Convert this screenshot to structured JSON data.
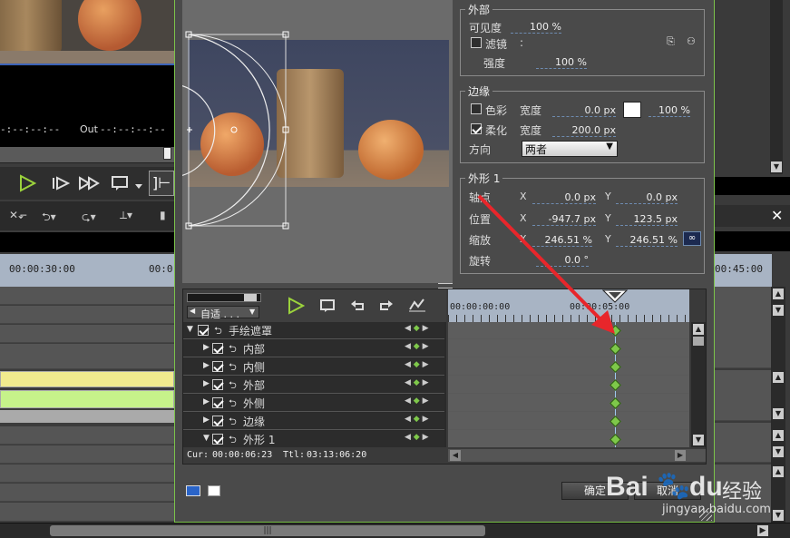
{
  "left": {
    "out_label": "Out",
    "in_tc": "-:--:--:--",
    "out_tc": "--:--:--:--",
    "ruler_tc": "00:00:30:00",
    "ruler_tc2": "00:0"
  },
  "right_ruler_tc": "00:45:00",
  "groups": {
    "inner": {
      "title": "外部",
      "visibility_label": "可见度",
      "visibility_value": "100 %",
      "filter_label": "滤镜",
      "filter_value": ":",
      "strength_label": "强度",
      "strength_value": "100 %"
    },
    "edge": {
      "title": "边缘",
      "color_label": "色彩",
      "width_label": "宽度",
      "color_width": "0.0 px",
      "color_opacity": "100 %",
      "soften_label": "柔化",
      "soften_width": "200.0 px",
      "direction_label": "方向",
      "direction_value": "两者"
    },
    "shape": {
      "title": "外形 1",
      "axis_label": "轴点",
      "axis_x": "0.0 px",
      "axis_y": "0.0 px",
      "pos_label": "位置",
      "pos_x": "-947.7 px",
      "pos_y": "123.5 px",
      "scale_label": "缩放",
      "scale_x": "246.51 %",
      "scale_y": "246.51 %",
      "rotate_label": "旋转",
      "rotate_value": "0.0 °",
      "x_label": "X",
      "y_label": "Y"
    }
  },
  "keyframe": {
    "preset_label": "自适 . . .",
    "ruler_start": "00:00:00:00",
    "ruler_mid": "00:00:05:00",
    "tracks": [
      {
        "label": "手绘遮罩",
        "level": 0,
        "expanded": true
      },
      {
        "label": "内部",
        "level": 1,
        "expanded": false
      },
      {
        "label": "内侧",
        "level": 1,
        "expanded": false
      },
      {
        "label": "外部",
        "level": 1,
        "expanded": false
      },
      {
        "label": "外侧",
        "level": 1,
        "expanded": false
      },
      {
        "label": "边缘",
        "level": 1,
        "expanded": false
      },
      {
        "label": "外形 1",
        "level": 1,
        "expanded": true
      }
    ],
    "cur_label": "Cur:",
    "cur_value": "00:00:06:23",
    "ttl_label": "Ttl:",
    "ttl_value": "03:13:06:20"
  },
  "buttons": {
    "ok": "确定",
    "cancel": "取消"
  },
  "watermark": {
    "brand": "Bai",
    "brand2": "du",
    "site_cn": "经验",
    "url": "jingyan.baidu.com"
  },
  "colors": {
    "accent_green": "#7ec84a",
    "play_green": "#9bd23c",
    "track_yellow": "#f1eb8e",
    "track_green": "#c6f28a",
    "arrow_red": "#e8262b"
  }
}
